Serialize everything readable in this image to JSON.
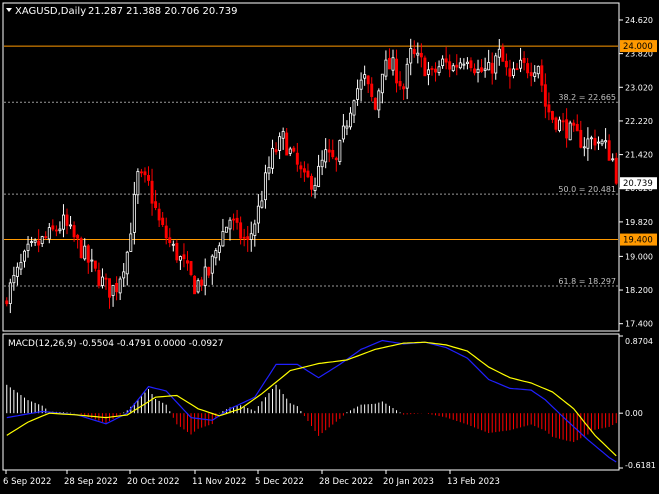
{
  "header": {
    "symbol": "XAGUSD,Daily",
    "ohlc": "21.287 21.388 20.706 20.739"
  },
  "colors": {
    "background": "#000000",
    "frame": "#ffffff",
    "axis_text": "#ffffff",
    "bull": "#ffffff",
    "bear": "#ff0000",
    "hline": "#ff9900",
    "fib_line": "#9a9a9a",
    "fib_text": "#c0c0c0",
    "macd_line": "#2020ff",
    "signal_line": "#ffff00",
    "hist_pos": "#ffffff",
    "hist_neg": "#ff0000",
    "price_tag_bg": "#ffffff",
    "hline_tag_bg": "#ff9900"
  },
  "chart_data": [
    {
      "type": "candlestick",
      "x_labels": [
        "6 Sep 2022",
        "28 Sep 2022",
        "20 Oct 2022",
        "11 Nov 2022",
        "5 Dec 2022",
        "28 Dec 2022",
        "20 Jan 2023",
        "13 Feb 2023"
      ],
      "y_ticks": [
        "24.620",
        "23.820",
        "23.020",
        "22.220",
        "21.420",
        "20.620",
        "19.820",
        "19.000",
        "18.200",
        "17.400"
      ],
      "ylim": [
        17.25,
        25.0
      ],
      "last_price": "20.739",
      "horizontal_lines": [
        {
          "label": "24.000",
          "value": 24.0
        },
        {
          "label": "19.400",
          "value": 19.4
        }
      ],
      "fib_levels": [
        {
          "label": "38.2 = 22.665",
          "value": 22.665
        },
        {
          "label": "50.0 = 20.481",
          "value": 20.481
        },
        {
          "label": "61.8 = 18.297",
          "value": 18.297
        }
      ],
      "close_path": [
        [
          0,
          18.1
        ],
        [
          6,
          19.1
        ],
        [
          12,
          19.5
        ],
        [
          16,
          19.8
        ],
        [
          20,
          19.3
        ],
        [
          25,
          18.6
        ],
        [
          29,
          18.2
        ],
        [
          31,
          18.3
        ],
        [
          34,
          19.1
        ],
        [
          37,
          20.9
        ],
        [
          40,
          20.7
        ],
        [
          43,
          19.8
        ],
        [
          46,
          19.3
        ],
        [
          50,
          18.8
        ],
        [
          53,
          18.3
        ],
        [
          57,
          18.6
        ],
        [
          60,
          19.4
        ],
        [
          63,
          19.9
        ],
        [
          65,
          19.6
        ],
        [
          68,
          19.3
        ],
        [
          71,
          20.1
        ],
        [
          73,
          20.8
        ],
        [
          75,
          21.4
        ],
        [
          78,
          21.8
        ],
        [
          81,
          21.3
        ],
        [
          84,
          20.8
        ],
        [
          87,
          20.8
        ],
        [
          90,
          21.4
        ],
        [
          93,
          21.2
        ],
        [
          95,
          21.9
        ],
        [
          98,
          22.9
        ],
        [
          101,
          23.2
        ],
        [
          104,
          22.5
        ],
        [
          106,
          23.5
        ],
        [
          109,
          23.5
        ],
        [
          112,
          23.0
        ],
        [
          114,
          23.8
        ],
        [
          117,
          23.6
        ],
        [
          120,
          23.3
        ],
        [
          123,
          23.6
        ],
        [
          126,
          23.5
        ],
        [
          130,
          23.8
        ],
        [
          133,
          23.4
        ],
        [
          136,
          23.4
        ],
        [
          139,
          23.8
        ],
        [
          142,
          23.2
        ],
        [
          145,
          23.5
        ],
        [
          148,
          23.5
        ],
        [
          150,
          23.6
        ],
        [
          152,
          22.6
        ],
        [
          154,
          22.3
        ],
        [
          157,
          22.1
        ],
        [
          160,
          21.9
        ],
        [
          163,
          21.7
        ],
        [
          166,
          21.8
        ],
        [
          169,
          21.6
        ],
        [
          171,
          21.3
        ],
        [
          172,
          20.74
        ]
      ],
      "candle_count": 173
    },
    {
      "type": "macd",
      "label": "MACD(12,26,9) -0.5504 -0.4791 0.0000 -0.0927",
      "y_ticks": [
        "0.8704",
        "0.00",
        "-0.6181"
      ],
      "ylim": [
        -0.6181,
        0.8704
      ],
      "macd_path": [
        [
          0,
          -0.05
        ],
        [
          10,
          0.02
        ],
        [
          20,
          -0.02
        ],
        [
          28,
          -0.12
        ],
        [
          34,
          0.0
        ],
        [
          40,
          0.3
        ],
        [
          45,
          0.25
        ],
        [
          52,
          -0.05
        ],
        [
          58,
          -0.08
        ],
        [
          63,
          0.05
        ],
        [
          70,
          0.18
        ],
        [
          76,
          0.55
        ],
        [
          82,
          0.55
        ],
        [
          88,
          0.4
        ],
        [
          94,
          0.55
        ],
        [
          100,
          0.72
        ],
        [
          106,
          0.82
        ],
        [
          112,
          0.78
        ],
        [
          118,
          0.8
        ],
        [
          124,
          0.74
        ],
        [
          130,
          0.62
        ],
        [
          136,
          0.38
        ],
        [
          142,
          0.28
        ],
        [
          148,
          0.26
        ],
        [
          152,
          0.15
        ],
        [
          158,
          -0.08
        ],
        [
          164,
          -0.3
        ],
        [
          170,
          -0.5
        ],
        [
          172,
          -0.55
        ]
      ],
      "signal_path": [
        [
          0,
          -0.25
        ],
        [
          6,
          -0.1
        ],
        [
          12,
          0.0
        ],
        [
          20,
          -0.02
        ],
        [
          28,
          -0.05
        ],
        [
          34,
          -0.02
        ],
        [
          42,
          0.18
        ],
        [
          48,
          0.2
        ],
        [
          54,
          0.05
        ],
        [
          60,
          -0.03
        ],
        [
          66,
          0.05
        ],
        [
          72,
          0.22
        ],
        [
          80,
          0.48
        ],
        [
          88,
          0.56
        ],
        [
          96,
          0.6
        ],
        [
          104,
          0.72
        ],
        [
          112,
          0.79
        ],
        [
          118,
          0.8
        ],
        [
          124,
          0.77
        ],
        [
          130,
          0.7
        ],
        [
          136,
          0.52
        ],
        [
          142,
          0.4
        ],
        [
          148,
          0.34
        ],
        [
          154,
          0.24
        ],
        [
          160,
          0.05
        ],
        [
          166,
          -0.25
        ],
        [
          172,
          -0.48
        ]
      ]
    }
  ]
}
